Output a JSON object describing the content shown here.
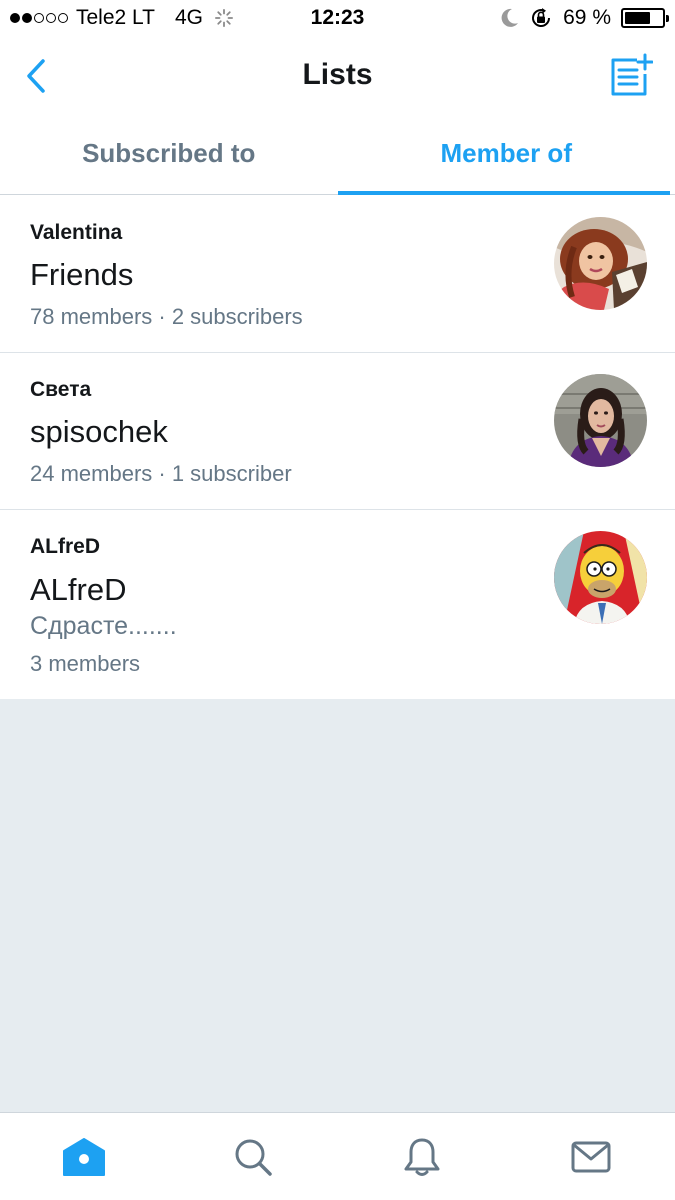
{
  "status_bar": {
    "carrier": "Tele2 LT",
    "network": "4G",
    "time": "12:23",
    "battery_text": "69 %",
    "battery_level": 0.69
  },
  "nav": {
    "title": "Lists"
  },
  "tabs": [
    {
      "label": "Subscribed to",
      "active": false
    },
    {
      "label": "Member of",
      "active": true
    }
  ],
  "lists": [
    {
      "owner": "Valentina",
      "name": "Friends",
      "description": "",
      "meta": "78 members · 2 subscribers",
      "avatar_icon": "avatar-photo-valentina"
    },
    {
      "owner": "Света",
      "name": "spisochek",
      "description": "",
      "meta": "24 members · 1 subscriber",
      "avatar_icon": "avatar-photo-sveta"
    },
    {
      "owner": "ALfreD",
      "name": "ALfreD",
      "description": "Сдрасте.......",
      "meta": "3 members",
      "avatar_icon": "avatar-homer-cartoon"
    }
  ],
  "tab_bar": [
    {
      "icon": "home-icon",
      "active": true
    },
    {
      "icon": "search-icon",
      "active": false
    },
    {
      "icon": "bell-icon",
      "active": false
    },
    {
      "icon": "mail-icon",
      "active": false
    }
  ],
  "colors": {
    "accent": "#1da1f2",
    "secondary_text": "#657786",
    "background_gray": "#e6ecf0"
  }
}
